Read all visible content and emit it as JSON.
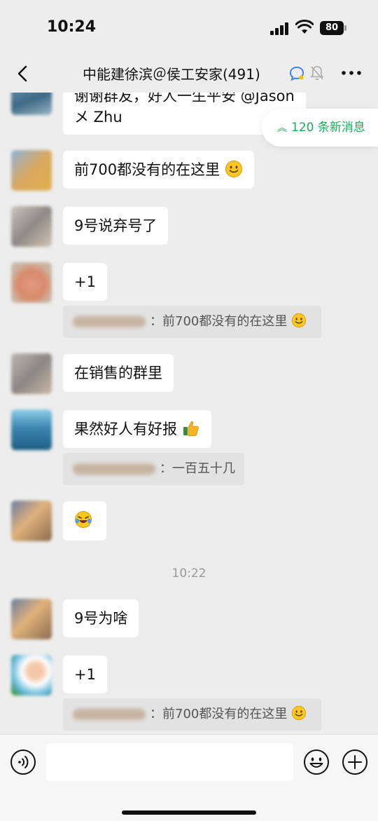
{
  "status_bar": {
    "time": "10:24",
    "battery": "80"
  },
  "header": {
    "title": "中能建徐滨＠侯工安家(491)"
  },
  "new_messages": {
    "label": "120 条新消息"
  },
  "messages": [
    {
      "text_line1": "谢谢群友，好人一生平安 @Jason",
      "text_line2": "メ Zhu"
    },
    {
      "text": "前700都没有的在这里"
    },
    {
      "text": "9号说弃号了"
    },
    {
      "text": "+1",
      "quote": "：前700都没有的在这里"
    },
    {
      "text": "在销售的群里"
    },
    {
      "text": "果然好人有好报",
      "quote": "：一百五十几"
    },
    {
      "text": ""
    },
    {
      "text": "9号为啥"
    },
    {
      "text": "+1",
      "quote": "：前700都没有的在这里"
    }
  ],
  "timestamp": "10:22",
  "input": {
    "placeholder": ""
  },
  "colors": {
    "accent_green": "#1aad5a",
    "bubble": "#ffffff",
    "background": "#ededed"
  }
}
